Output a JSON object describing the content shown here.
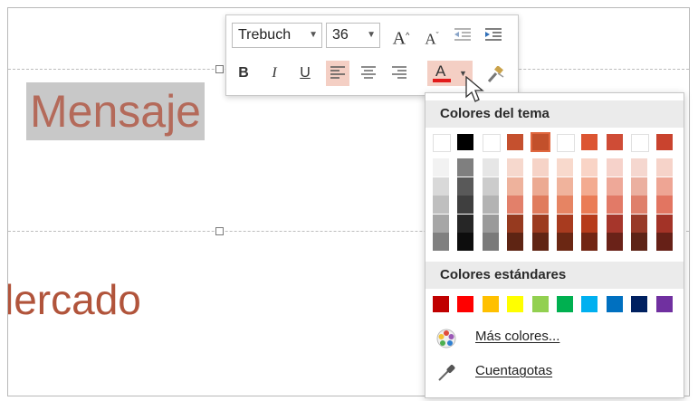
{
  "slide": {
    "title": "Mensaje",
    "subtitle": "lercado"
  },
  "toolbar": {
    "font_name": "Trebuch",
    "font_size": "36",
    "grow_font": "A",
    "shrink_font": "A",
    "bold": "B",
    "italic": "I",
    "underline": "U",
    "font_color_letter": "A",
    "font_color_current": "#e21b1b"
  },
  "color_menu": {
    "theme_header": "Colores del tema",
    "theme_top_row": [
      "#ffffff",
      "#000000",
      "#ffffff",
      "#c5502e",
      "#c2502b",
      "#ffffff",
      "#dc5532",
      "#cf4c36",
      "#ffffff",
      "#c9432e"
    ],
    "theme_shades": [
      [
        "#f2f2f2",
        "#d9d9d9",
        "#bfbfbf",
        "#a6a6a6",
        "#808080"
      ],
      [
        "#7f7f7f",
        "#595959",
        "#3f3f3f",
        "#262626",
        "#0d0d0d"
      ],
      [
        "#e6e6e6",
        "#cccccc",
        "#b3b3b3",
        "#9a9a9a",
        "#7a7a7a"
      ],
      [
        "#f6d8cd",
        "#eeb29c",
        "#e2806a",
        "#963a1f",
        "#5e2413"
      ],
      [
        "#f6d3c7",
        "#ecaa92",
        "#e07c5d",
        "#9c3b1f",
        "#612514"
      ],
      [
        "#f8d9cc",
        "#f0b39c",
        "#e68463",
        "#a83b1f",
        "#6b2713"
      ],
      [
        "#f9d4c6",
        "#f3ab90",
        "#ea7c56",
        "#b63b1b",
        "#722513"
      ],
      [
        "#f6d2ca",
        "#eea898",
        "#e27a67",
        "#a6362b",
        "#6a2218"
      ],
      [
        "#f5d7cf",
        "#ebb0a0",
        "#df806b",
        "#983a28",
        "#5e2417"
      ],
      [
        "#f6d3c9",
        "#eea594",
        "#e27561",
        "#a33327",
        "#662017"
      ]
    ],
    "standard_header": "Colores estándares",
    "standard_colors": [
      "#c00000",
      "#ff0000",
      "#ffc000",
      "#ffff00",
      "#92d050",
      "#00b050",
      "#00b0f0",
      "#0070c0",
      "#002060",
      "#7030a0"
    ],
    "more_colors": "Más colores...",
    "eyedropper": "Cuentagotas"
  }
}
